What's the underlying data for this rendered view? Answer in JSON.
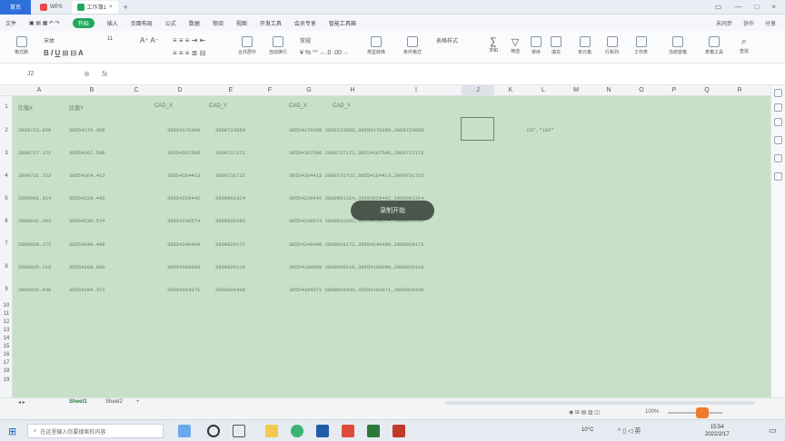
{
  "tabs": {
    "home": "首页",
    "doc1": "WPS",
    "doc2": "工作簿1"
  },
  "menu": {
    "items": [
      "文件",
      "开始",
      "插入",
      "页面布局",
      "公式",
      "数据",
      "审阅",
      "视图",
      "开发工具",
      "会员专享",
      "智能工具箱"
    ],
    "active": "开始",
    "right": [
      "未同步",
      "协作",
      "分享"
    ]
  },
  "ribbon": {
    "font_name": "宋体",
    "font_size": "11",
    "labels": [
      "格式刷",
      "粘贴",
      "合并居中",
      "自动换行",
      "常规",
      "条件格式",
      "表格样式",
      "求和",
      "筛选",
      "排序",
      "填充",
      "单元格",
      "行和列",
      "工作表",
      "冻结窗格",
      "表格工具",
      "查找"
    ]
  },
  "formula": {
    "namebox": "J2",
    "fx": "fx"
  },
  "columns": [
    "A",
    "B",
    "C",
    "D",
    "E",
    "F",
    "G",
    "H",
    "I",
    "J",
    "K",
    "L",
    "M",
    "N",
    "O",
    "P",
    "Q",
    "R"
  ],
  "selected_column": "J",
  "rows": [
    "1",
    "2",
    "3",
    "4",
    "5",
    "6",
    "7",
    "8",
    "9",
    "10",
    "11",
    "12",
    "13",
    "14",
    "15",
    "16",
    "17",
    "18",
    "19"
  ],
  "header_row": {
    "a": "比值X",
    "b": "比值Y",
    "d": "CAD_X",
    "e": "CAD_Y",
    "g": "CAD_X",
    "h": "CAD_Y"
  },
  "data_rows": [
    {
      "a": "2860723.850",
      "b": "38554170.399",
      "d": "38554170399",
      "e": "2860723850",
      "gh": "38554170399  2860723850,38554170399,2860723850"
    },
    {
      "a": "2860727.172",
      "b": "38554167.596",
      "d": "38554167596",
      "e": "2860727172",
      "gh": "38554167596  2860727172,38554167596,2860727172"
    },
    {
      "a": "2860731.722",
      "b": "38554164.413",
      "d": "38554164413",
      "e": "2860731722",
      "gh": "38554164413  2860731722,38554164413,2860731722"
    },
    {
      "a": "2860901.314",
      "b": "38554229.442",
      "d": "38554229442",
      "e": "2860901314",
      "gh": "38554229442  2860901314,38554229442,2860901314"
    },
    {
      "a": "2860932.292",
      "b": "38554230.574",
      "d": "38554230574",
      "e": "2860932292",
      "gh": "38554230574  2860932292,38554230574,2860932292"
    },
    {
      "a": "2860929.172",
      "b": "38554240.498",
      "d": "38554240498",
      "e": "2860929172",
      "gh": "38554240498  2860929172,38554240498,2860929172"
    },
    {
      "a": "2860926.116",
      "b": "38554189.099",
      "d": "38554189099",
      "e": "2860926116",
      "gh": "38554189099  2860926116,38554189099,2860926116"
    },
    {
      "a": "2860926.430",
      "b": "38554184.371",
      "d": "38554184371",
      "e": "2860926430",
      "gh": "38554184371  2860926430,38554184371,2860926430"
    }
  ],
  "note_cell": "CO\",\"102\"",
  "toast": "录制开始",
  "sheets": [
    "Sheet1",
    "Sheet2"
  ],
  "status": {
    "zoom": "100%"
  },
  "taskbar": {
    "search_placeholder": "在这里输入你要搜索的内容",
    "temp": "10°C",
    "time": "15:54",
    "date": "2022/2/17"
  },
  "colors": {
    "grid_bg": "#c8e0c7",
    "accent": "#1eaa5a",
    "toast_bg": "#4a564c"
  }
}
